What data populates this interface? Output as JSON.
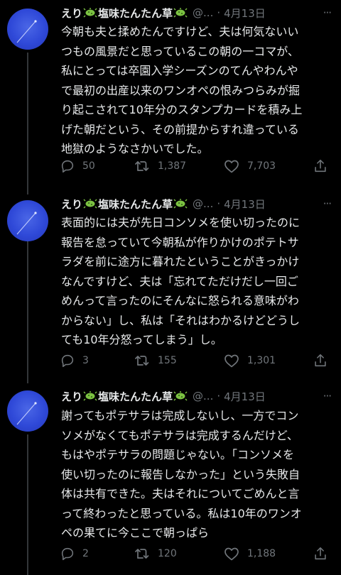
{
  "tweets": [
    {
      "author_name": "えり",
      "author_suffix": "塩味たんたん草",
      "handle": "@...",
      "date": "4月13日",
      "text_lines": [
        "今朝も夫と揉めたんですけど、夫は何気ないい",
        "つもの風景だと思っているこの朝の一コマが、",
        "私にとっては卒園入学シーズンのてんやわんや",
        "で最初の出産以来のワンオペの恨みつらみが掘",
        "り起こされて10年分のスタンプカードを積み上",
        "げた朝だという、その前提からすれ違っている",
        "地獄のようなさかいでした。"
      ],
      "replies": "50",
      "retweets": "1,387",
      "likes": "7,703"
    },
    {
      "author_name": "えり",
      "author_suffix": "塩味たんたん草",
      "handle": "@...",
      "date": "4月13日",
      "text_lines": [
        "表面的には夫が先日コンソメを使い切ったのに",
        "報告を怠っていて今朝私が作りかけのポテトサ",
        "ラダを前に途方に暮れたということがきっかけ",
        "なんですけど、夫は「忘れてただけだし一回ご",
        "めんって言ったのにそんなに怒られる意味がわ",
        "からない」し、私は「それはわかるけどどうし",
        "ても10年分怒ってしまう」し。"
      ],
      "replies": "3",
      "retweets": "155",
      "likes": "1,301"
    },
    {
      "author_name": "えり",
      "author_suffix": "塩味たんたん草",
      "handle": "@...",
      "date": "4月13日",
      "text_lines": [
        "謝ってもポテサラは完成しないし、一方でコン",
        "ソメがなくてもポテサラは完成するんだけど、",
        "もはやポテサラの問題じゃない。「コンソメを",
        "使い切ったのに報告しなかった」という失敗自",
        "体は共有できた。夫はそれについてごめんと言",
        "って終わったと思っている。私は10年のワンオ",
        "ペの果てに今ここで朝っぱら"
      ],
      "replies": "2",
      "retweets": "120",
      "likes": "1,188"
    }
  ],
  "colors": {
    "background": "#000000",
    "text": "#e7e9ea",
    "muted": "#71767b",
    "avatar": "#2f49d8",
    "emoji_green": "#7cc242"
  },
  "icons": [
    "avatar",
    "virus-emoji-icon",
    "more-icon",
    "reply-icon",
    "retweet-icon",
    "like-icon",
    "share-icon"
  ]
}
